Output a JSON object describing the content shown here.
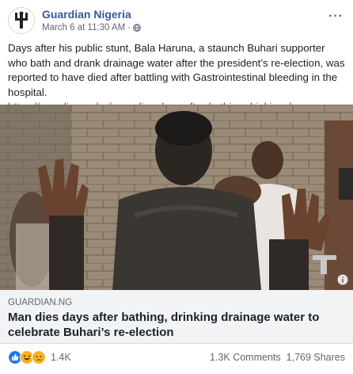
{
  "post": {
    "page_name": "Guardian Nigeria",
    "timestamp": "March 6 at 11:30 AM",
    "separator": "·",
    "privacy_icon": "globe-icon",
    "more_label": "···",
    "body": "Days after his public stunt, Bala Haruna, a staunch Buhari supporter who bath and drank drainage water after the president’s re-election, was reported to have died after battling with Gastrointestinal bleeding in the hospital.",
    "url": "https://guardian.ng/…/man-dies-days-after-bathing-drinkin…/…"
  },
  "preview": {
    "domain": "GUARDIAN.NG",
    "title": "Man dies days after bathing, drinking drainage water to celebrate Buhari’s re-election"
  },
  "engagement": {
    "reactions": [
      "like",
      "haha",
      "sad"
    ],
    "reaction_count": "1.4K",
    "comments": "1.3K Comments",
    "shares": "1,769 Shares"
  },
  "colors": {
    "link": "#365899",
    "like": "#1877f2",
    "haha": "#f7b125"
  }
}
